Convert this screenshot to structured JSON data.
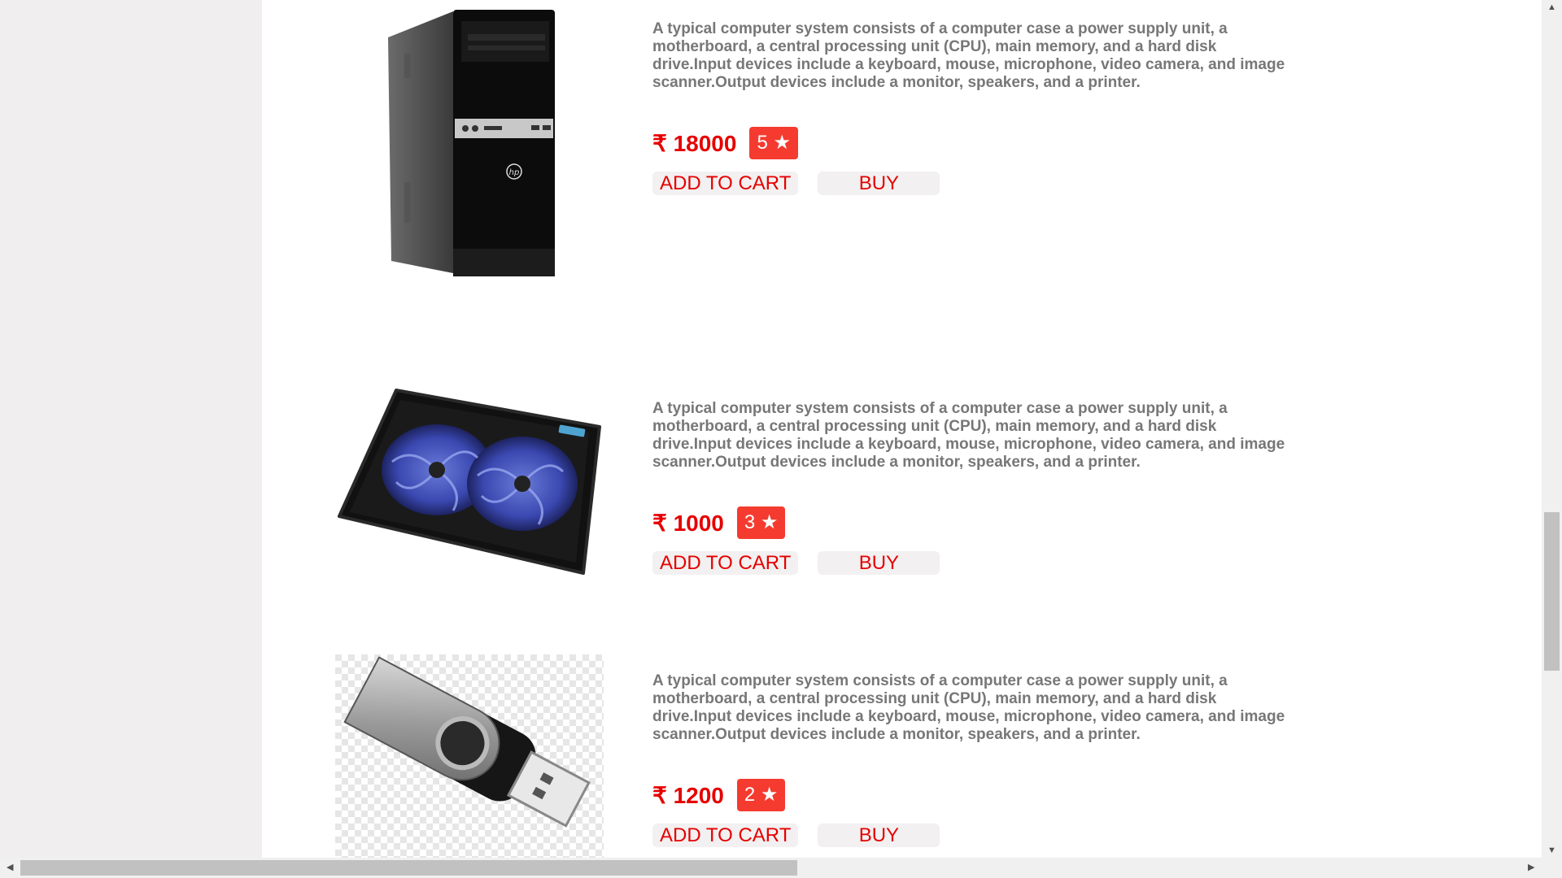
{
  "products": [
    {
      "image_icon": "desktop-tower-image",
      "description": "A typical computer system consists of a computer case a power supply unit, a motherboard, a central processing unit (CPU), main memory, and a hard disk drive.Input devices include a keyboard, mouse, microphone, video camera, and image scanner.Output devices include a monitor, speakers, and a printer.",
      "price": "₹ 18000",
      "rating": "5 ★",
      "add_to_cart": "ADD TO CART",
      "buy": "BUY"
    },
    {
      "image_icon": "laptop-cooling-pad-image",
      "description": "A typical computer system consists of a computer case a power supply unit, a motherboard, a central processing unit (CPU), main memory, and a hard disk drive.Input devices include a keyboard, mouse, microphone, video camera, and image scanner.Output devices include a monitor, speakers, and a printer.",
      "price": "₹ 1000",
      "rating": "3 ★",
      "add_to_cart": "ADD TO CART",
      "buy": "BUY"
    },
    {
      "image_icon": "usb-flash-drive-image",
      "description": "A typical computer system consists of a computer case a power supply unit, a motherboard, a central processing unit (CPU), main memory, and a hard disk drive.Input devices include a keyboard, mouse, microphone, video camera, and image scanner.Output devices include a monitor, speakers, and a printer.",
      "price": "₹ 1200",
      "rating": "2 ★",
      "add_to_cart": "ADD TO CART",
      "buy": "BUY"
    }
  ],
  "colors": {
    "price": "#e60000",
    "rating_badge": "#f53b30",
    "button_bg": "#f2f0f0",
    "description": "#777777"
  }
}
